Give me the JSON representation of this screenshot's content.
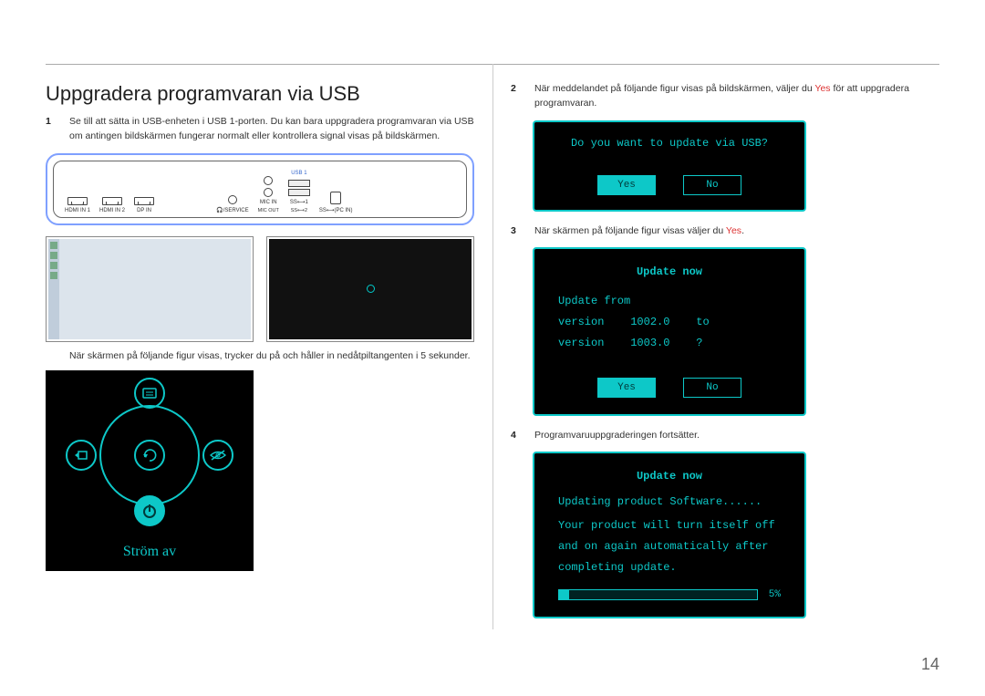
{
  "page": {
    "title": "Uppgradera programvaran via USB",
    "pageNumber": "14"
  },
  "left": {
    "step1": {
      "num": "1",
      "text": "Se till att sätta in USB-enheten i USB 1-porten. Du kan bara uppgradera programvaran via USB om antingen bildskärmen fungerar normalt eller kontrollera signal visas på bildskärmen."
    },
    "ports": {
      "usb1_label": "USB 1",
      "hdmi1": "HDMI IN 1",
      "hdmi2": "HDMI IN 2",
      "dpin": "DP IN",
      "service": "🎧/SERVICE",
      "micin": "MIC IN",
      "micout": "MIC OUT",
      "ss1": "SS⟷1",
      "ss2": "SS⟷2",
      "pcin": "SS⟷(PC IN)"
    },
    "substep_text": "När skärmen på följande figur visas, trycker du på och håller in nedåtpiltangenten i 5 sekunder.",
    "jog": {
      "power_label": "Ström av"
    }
  },
  "right": {
    "step2": {
      "num": "2",
      "text_a": "När meddelandet på följande figur visas på bildskärmen, väljer du ",
      "yes": "Yes",
      "text_b": " för att uppgradera programvaran."
    },
    "dialog1": {
      "question": "Do you want to update via USB?",
      "yes": "Yes",
      "no": "No"
    },
    "step3": {
      "num": "3",
      "text_a": "När skärmen på följande figur visas väljer du ",
      "yes": "Yes",
      "text_b": "."
    },
    "dialog2": {
      "title": "Update now",
      "line1_a": "Update from version",
      "ver_from": "1002.0",
      "line1_b": "to",
      "line2_a": "version",
      "ver_to": "1003.0",
      "line2_b": "?",
      "yes": "Yes",
      "no": "No"
    },
    "step4": {
      "num": "4",
      "text": "Programvaruuppgraderingen fortsätter."
    },
    "dialog3": {
      "title": "Update now",
      "line1": "Updating product Software......",
      "line2": "Your product will turn itself off and on again automatically after completing update.",
      "progress_pct": "5%",
      "progress_value": 5
    }
  }
}
